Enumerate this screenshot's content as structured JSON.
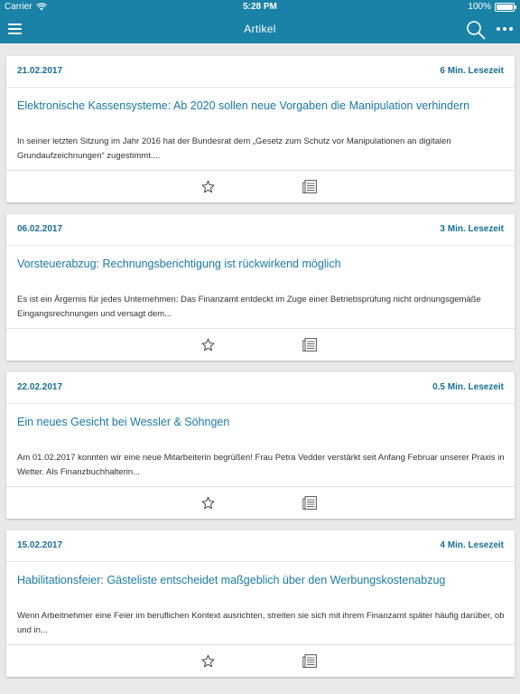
{
  "status_bar": {
    "carrier": "Carrier",
    "time": "5:28 PM",
    "battery": "100%"
  },
  "nav": {
    "title": "Artikel"
  },
  "articles": [
    {
      "date": "21.02.2017",
      "reading_time": "6 Min. Lesezeit",
      "title": "Elektronische Kassensysteme: Ab 2020 sollen neue Vorgaben die Manipulation verhindern",
      "excerpt": "In seiner letzten Sitzung im Jahr 2016 hat der Bundesrat dem „Gesetz zum Schutz vor Manipulationen an digitalen Grundaufzeichnungen“ zugestimmt...."
    },
    {
      "date": "06.02.2017",
      "reading_time": "3 Min. Lesezeit",
      "title": "Vorsteuerabzug: Rechnungsberichtigung ist rückwirkend möglich",
      "excerpt": "Es ist ein Ärgernis für jedes Unternehmen: Das Finanzamt entdeckt im Zuge einer Betriebsprüfung nicht ordnungsgemäße Eingangsrechnungen und versagt dem..."
    },
    {
      "date": "22.02.2017",
      "reading_time": "0.5 Min. Lesezeit",
      "title": "Ein neues Gesicht bei Wessler & Söhngen",
      "excerpt": "Am 01.02.2017 konnten wir eine neue Mitarbeiterin begrüßen! Frau Petra Vedder verstärkt seit Anfang Februar unserer Praxis in Wetter. Als Finanzbuchhalterin..."
    },
    {
      "date": "15.02.2017",
      "reading_time": "4 Min. Lesezeit",
      "title": "Habilitationsfeier: Gästeliste entscheidet maßgeblich über den Werbungskostenabzug",
      "excerpt": "Wenn Arbeitnehmer eine Feier im beruflichen Kontext ausrichten, streiten sie sich mit ihrem Finanzamt später häufig darüber, ob und in..."
    }
  ],
  "colors": {
    "brand": "#1a82a6",
    "link": "#1a7aa3",
    "background": "#e9e9e9"
  },
  "icons": [
    "menu-icon",
    "search-icon",
    "more-icon",
    "star-icon",
    "article-icon",
    "wifi-icon",
    "battery-icon"
  ]
}
